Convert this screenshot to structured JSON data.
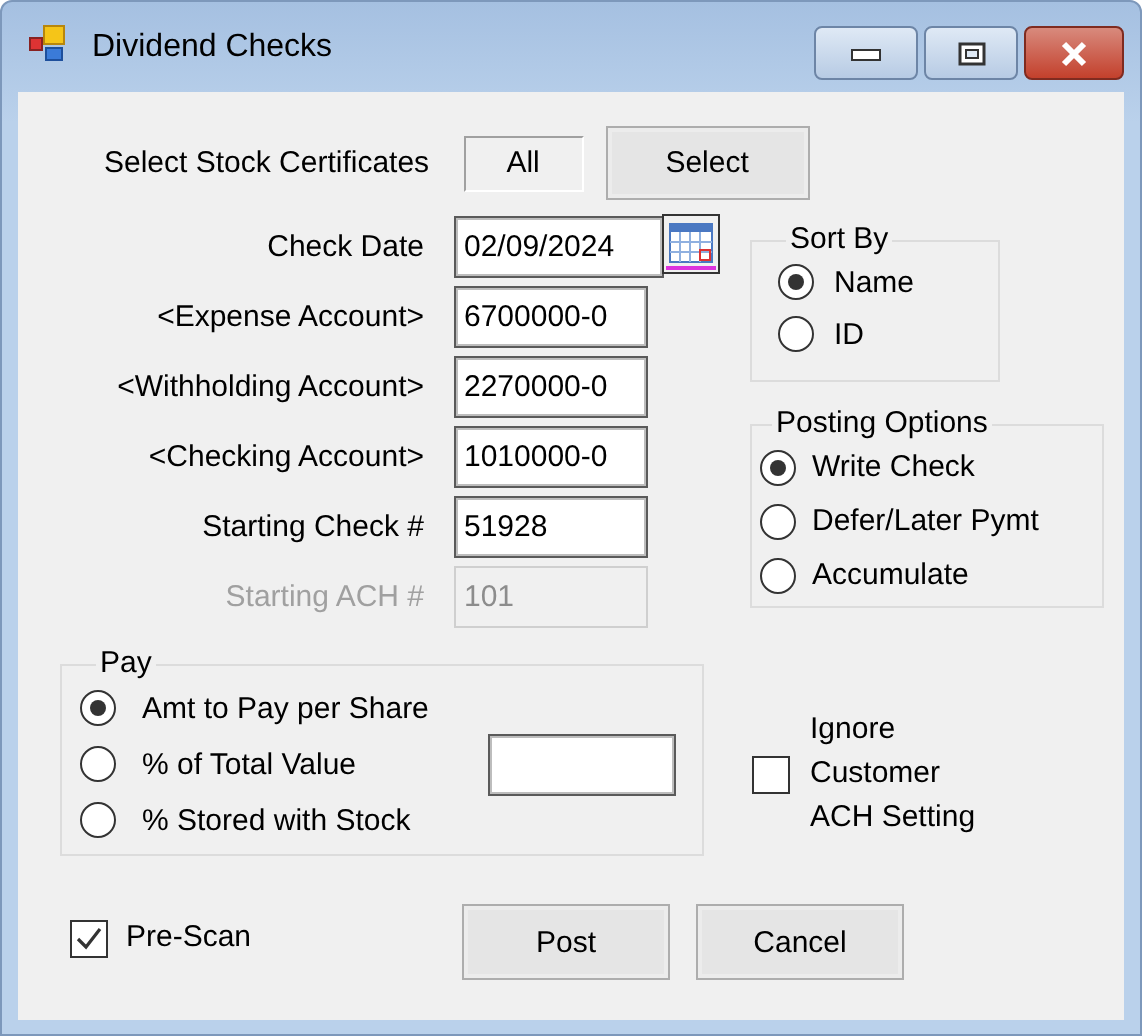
{
  "window": {
    "title": "Dividend Checks"
  },
  "certificates": {
    "label": "Select Stock Certificates",
    "value": "All",
    "button": "Select"
  },
  "fields": [
    {
      "label": "Check Date",
      "value": "02/09/2024",
      "kind": "date",
      "disabled": false
    },
    {
      "label": "<Expense Account>",
      "value": "6700000-0",
      "kind": "text",
      "disabled": false
    },
    {
      "label": "<Withholding Account>",
      "value": "2270000-0",
      "kind": "text",
      "disabled": false
    },
    {
      "label": "<Checking Account>",
      "value": "1010000-0",
      "kind": "text",
      "disabled": false
    },
    {
      "label": "Starting Check #",
      "value": "51928",
      "kind": "text",
      "disabled": false
    },
    {
      "label": "Starting ACH #",
      "value": "101",
      "kind": "text",
      "disabled": true
    }
  ],
  "sort_by": {
    "title": "Sort By",
    "options": [
      {
        "label": "Name",
        "selected": true
      },
      {
        "label": "ID",
        "selected": false
      }
    ]
  },
  "posting_options": {
    "title": "Posting Options",
    "options": [
      {
        "label": "Write Check",
        "selected": true
      },
      {
        "label": "Defer/Later Pymt",
        "selected": false
      },
      {
        "label": "Accumulate",
        "selected": false
      }
    ]
  },
  "pay": {
    "title": "Pay",
    "options": [
      {
        "label": "Amt to Pay per Share",
        "selected": true
      },
      {
        "label": "% of Total Value",
        "selected": false
      },
      {
        "label": "% Stored with Stock",
        "selected": false
      }
    ]
  },
  "ignore_ach": {
    "label": "Ignore Customer ACH Setting",
    "checked": false
  },
  "pre_scan": {
    "label": "Pre-Scan",
    "checked": true
  },
  "buttons": [
    "Post",
    "Cancel"
  ]
}
